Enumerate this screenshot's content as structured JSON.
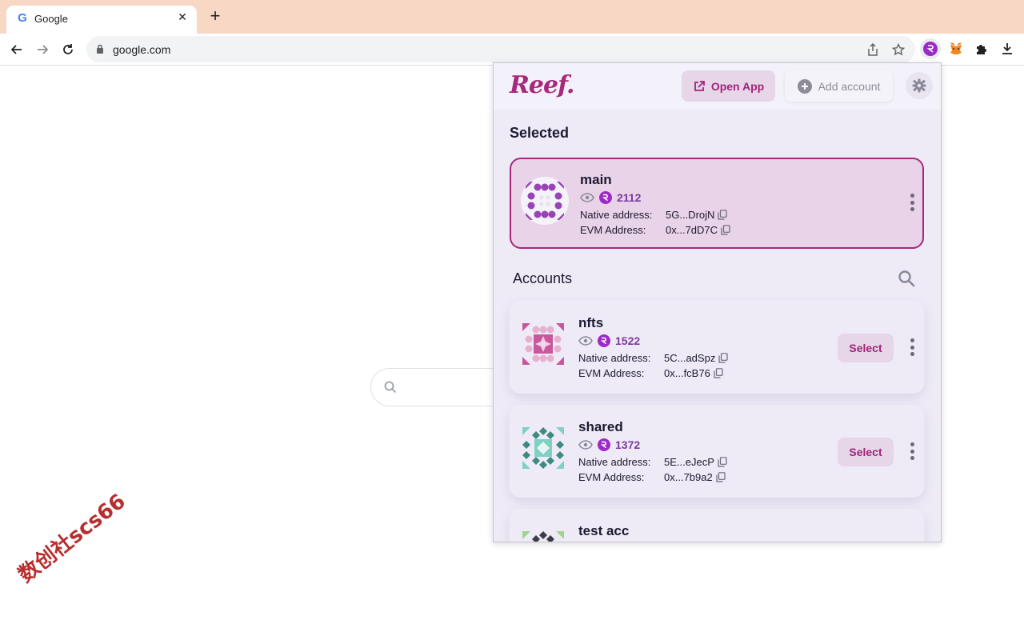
{
  "browser": {
    "tab_title": "Google",
    "tab_close": "✕",
    "new_tab": "+",
    "url": "google.com"
  },
  "popup": {
    "logo": "Reef.",
    "open_app_label": "Open App",
    "add_account_label": "Add account",
    "selected_title": "Selected",
    "accounts_title": "Accounts",
    "selected_account": {
      "name": "main",
      "balance": "2112",
      "native_label": "Native address:",
      "native_address": "5G...DrojN",
      "evm_label": "EVM Address:",
      "evm_address": "0x...7dD7C"
    },
    "accounts": [
      {
        "name": "nfts",
        "balance": "1522",
        "native_label": "Native address:",
        "native_address": "5C...adSpz",
        "evm_label": "EVM Address:",
        "evm_address": "0x...fcB76",
        "select_label": "Select"
      },
      {
        "name": "shared",
        "balance": "1372",
        "native_label": "Native address:",
        "native_address": "5E...eJecP",
        "evm_label": "EVM Address:",
        "evm_address": "0x...7b9a2",
        "select_label": "Select"
      },
      {
        "name": "test acc"
      }
    ]
  },
  "watermark": "数创社scs66",
  "colors": {
    "reef_accent": "#a8287e",
    "balance": "#7b3a9e",
    "tabstrip": "#f8d8c4"
  }
}
